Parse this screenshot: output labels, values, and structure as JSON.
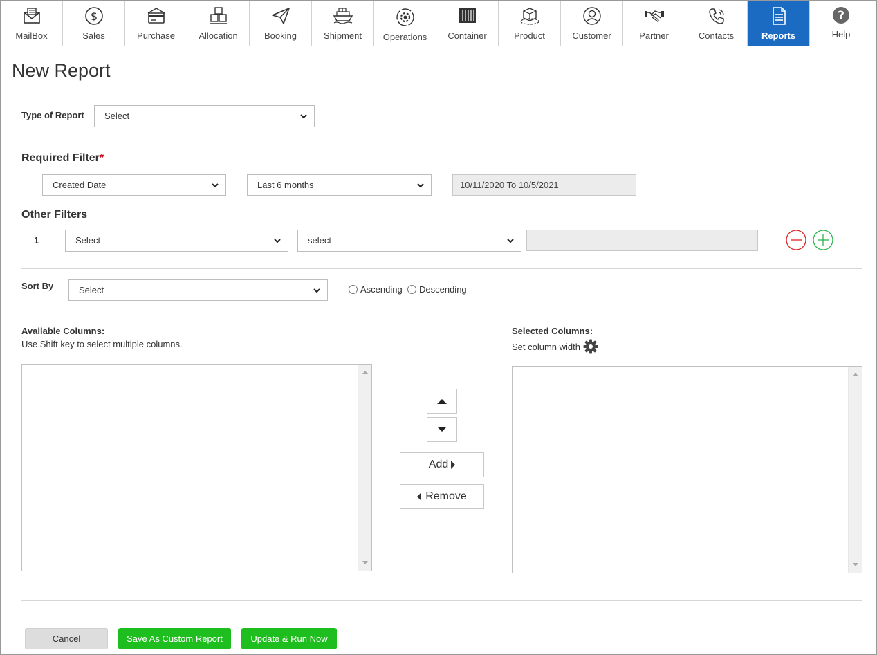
{
  "nav": [
    {
      "label": "MailBox",
      "icon": "mailbox-icon"
    },
    {
      "label": "Sales",
      "icon": "dollar-icon"
    },
    {
      "label": "Purchase",
      "icon": "credit-card-icon"
    },
    {
      "label": "Allocation",
      "icon": "boxes-icon"
    },
    {
      "label": "Booking",
      "icon": "paper-plane-icon"
    },
    {
      "label": "Shipment",
      "icon": "ship-icon"
    },
    {
      "label": "Operations",
      "icon": "gear-cycle-icon"
    },
    {
      "label": "Container",
      "icon": "container-icon"
    },
    {
      "label": "Product",
      "icon": "product-box-icon"
    },
    {
      "label": "Customer",
      "icon": "user-icon"
    },
    {
      "label": "Partner",
      "icon": "handshake-icon"
    },
    {
      "label": "Contacts",
      "icon": "phone-icon"
    },
    {
      "label": "Reports",
      "icon": "document-icon",
      "active": true
    },
    {
      "label": "Help",
      "icon": "question-icon"
    }
  ],
  "page": {
    "title": "New Report"
  },
  "type_of_report": {
    "label": "Type of Report",
    "value": "Select"
  },
  "required_filter": {
    "heading": "Required Filter",
    "star": "*",
    "field": "Created Date",
    "range": "Last 6 months",
    "dates": "10/11/2020 To 10/5/2021"
  },
  "other_filters": {
    "heading": "Other Filters",
    "rows": [
      {
        "num": "1",
        "field": "Select",
        "operator": "select",
        "value": ""
      }
    ]
  },
  "sort": {
    "label": "Sort By",
    "value": "Select",
    "ascending": "Ascending",
    "descending": "Descending"
  },
  "columns": {
    "available_heading": "Available Columns:",
    "available_note": "Use Shift key to select multiple columns.",
    "selected_heading": "Selected Columns:",
    "selected_note": "Set column width",
    "add_label": "Add",
    "remove_label": "Remove"
  },
  "footer": {
    "cancel": "Cancel",
    "save": "Save As Custom Report",
    "run": "Update & Run Now"
  },
  "colors": {
    "accent": "#1a6bc1",
    "primary_green": "#1fbe1f",
    "remove_red": "#e02020",
    "add_green": "#2db34a"
  }
}
